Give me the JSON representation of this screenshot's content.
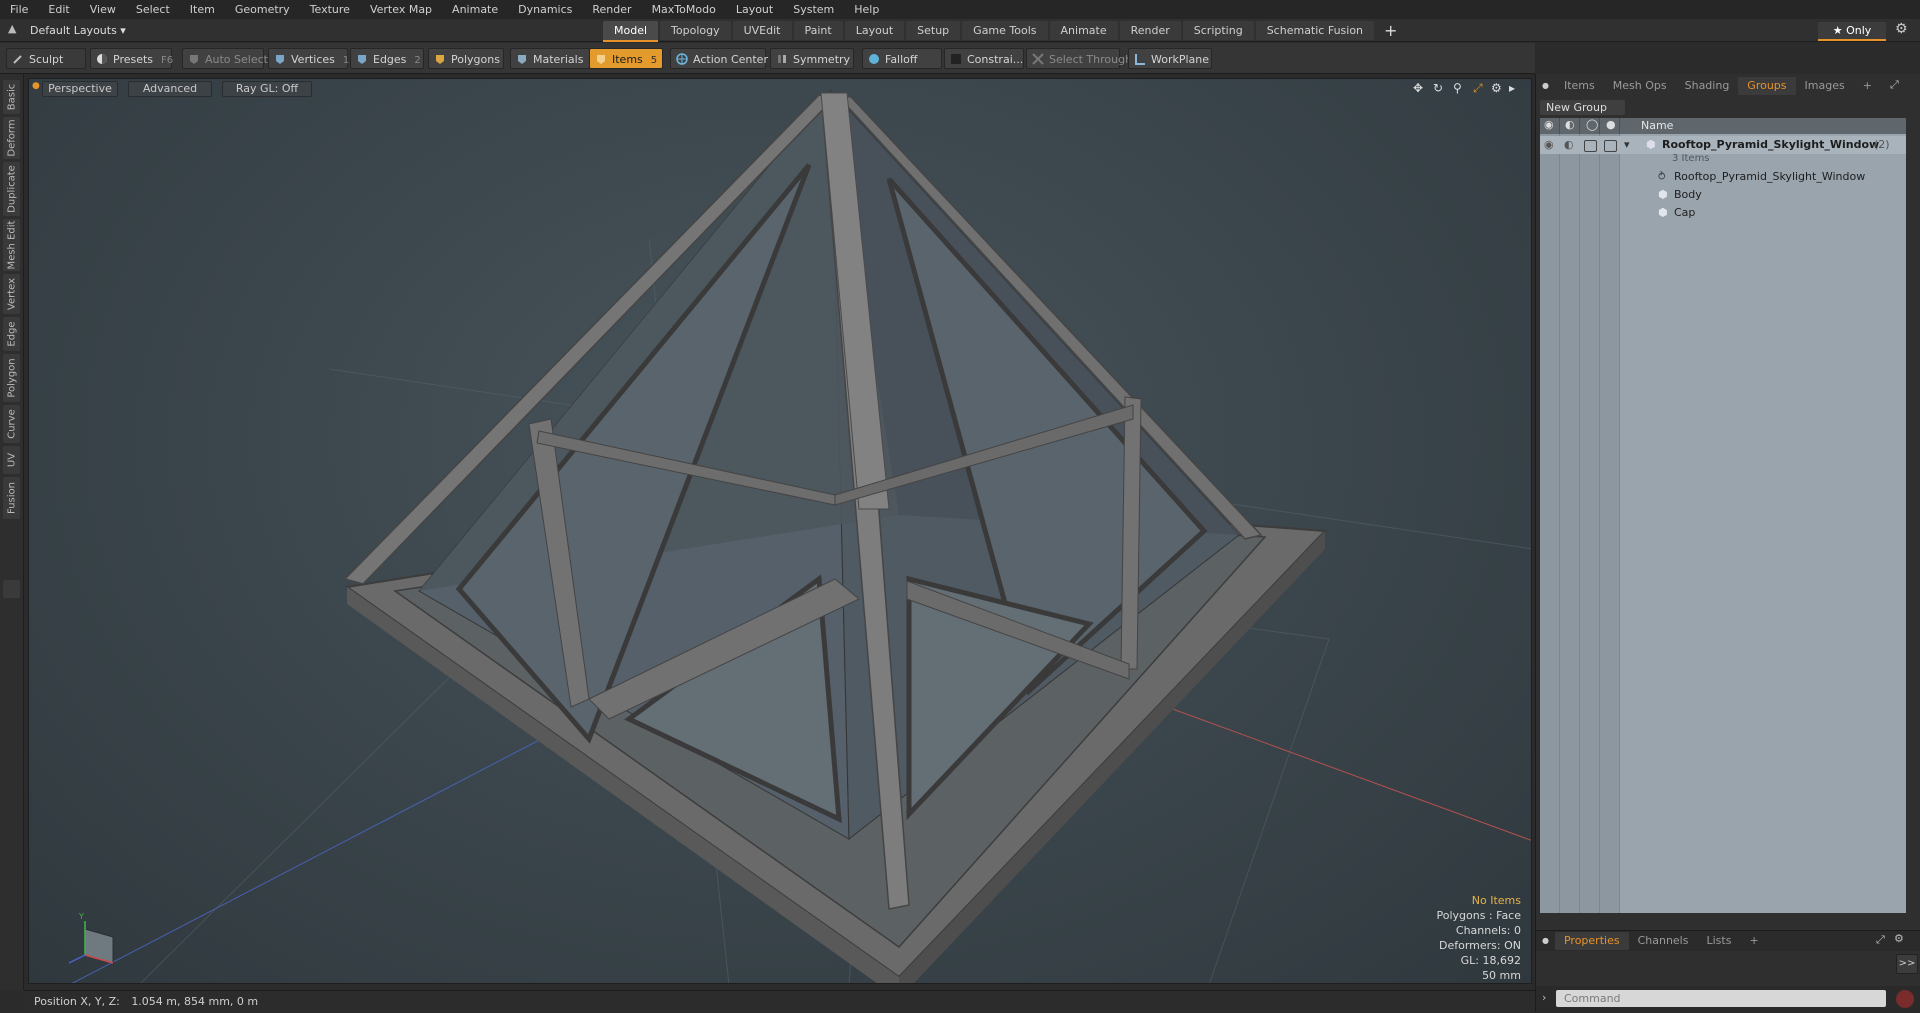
{
  "menu": [
    "File",
    "Edit",
    "View",
    "Select",
    "Item",
    "Geometry",
    "Texture",
    "Vertex Map",
    "Animate",
    "Dynamics",
    "Render",
    "MaxToModo",
    "Layout",
    "System",
    "Help"
  ],
  "layout_selector": "Default Layouts ▾",
  "workspace_tabs": [
    "Model",
    "Topology",
    "UVEdit",
    "Paint",
    "Layout",
    "Setup",
    "Game Tools",
    "Animate",
    "Render",
    "Scripting",
    "Schematic Fusion"
  ],
  "active_tab": "Model",
  "only_label": "★ Only",
  "toolbar": {
    "sculpt": "Sculpt",
    "presets": "Presets",
    "presets_key": "F6",
    "auto_select": "Auto Select",
    "vertices": "Vertices",
    "vertices_count": "1",
    "edges": "Edges",
    "edges_count": "2",
    "polygons": "Polygons",
    "materials": "Materials",
    "items": "Items",
    "items_count": "5",
    "action_center": "Action Center",
    "symmetry": "Symmetry",
    "falloff": "Falloff",
    "constrain": "Constrai...",
    "select_through": "Select Through",
    "workplane": "WorkPlane"
  },
  "left_tabs": [
    "Basic",
    "Deform",
    "Duplicate",
    "Mesh Edit",
    "Vertex",
    "Edge",
    "Polygon",
    "Curve",
    "UV",
    "Fusion"
  ],
  "viewport": {
    "view_mode": "Perspective",
    "shading": "Advanced",
    "raygl": "Ray GL: Off",
    "info": {
      "selection": "No Items",
      "polygons": "Polygons : Face",
      "channels": "Channels: 0",
      "deformers": "Deformers: ON",
      "gl": "GL: 18,692",
      "scale": "50 mm"
    },
    "axis_y": "Y"
  },
  "status": {
    "label": "Position X, Y, Z:",
    "value": "1.054 m, 854 mm, 0 m"
  },
  "right_panel": {
    "tabs": [
      "Items",
      "Mesh Ops",
      "Shading",
      "Groups",
      "Images"
    ],
    "active_tab": "Groups",
    "new_group": "New Group",
    "column_name": "Name",
    "group": {
      "name": "Rooftop_Pyramid_Skylight_Window",
      "count": "(2)",
      "items_label": "3 Items",
      "children": [
        "Rooftop_Pyramid_Skylight_Window",
        "Body",
        "Cap"
      ]
    },
    "bottom_tabs": [
      "Properties",
      "Channels",
      "Lists"
    ],
    "bottom_active": "Properties",
    "command_placeholder": "Command",
    "expand": ">>"
  },
  "colors": {
    "accent": "#e8922a",
    "viewport": "#3a454b",
    "outliner": "#9aa4ad"
  }
}
